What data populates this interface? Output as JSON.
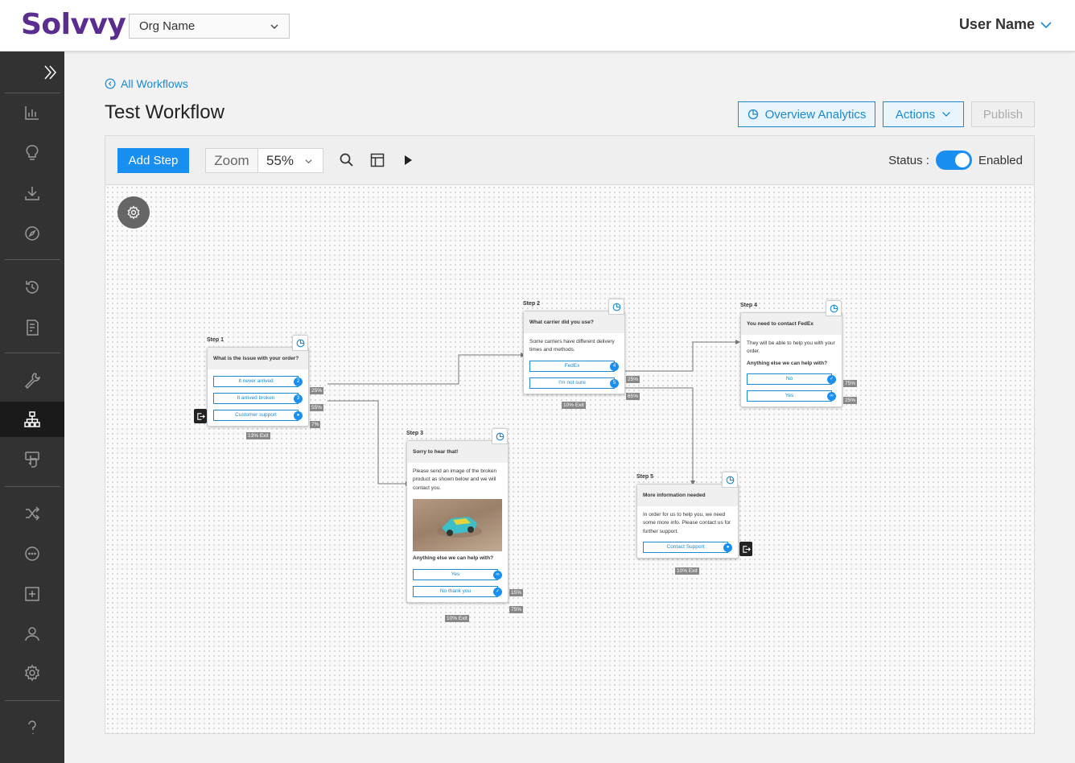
{
  "app": {
    "logo": "Solvvy",
    "org": "Org Name",
    "user": "User Name"
  },
  "sidebar": {
    "items": [
      {
        "name": "sidebar-expand",
        "icon": "double-chevron-right-icon"
      },
      {
        "name": "sidebar-item-analytics",
        "icon": "bar-chart-icon"
      },
      {
        "name": "sidebar-item-insights",
        "icon": "lightbulb-icon"
      },
      {
        "name": "sidebar-item-import",
        "icon": "download-icon"
      },
      {
        "name": "sidebar-item-explore",
        "icon": "compass-icon"
      },
      {
        "name": "sidebar-item-history",
        "icon": "history-icon"
      },
      {
        "name": "sidebar-item-reports",
        "icon": "report-icon"
      },
      {
        "name": "sidebar-item-tools",
        "icon": "wrench-icon"
      },
      {
        "name": "sidebar-item-workflows",
        "icon": "workflow-icon"
      },
      {
        "name": "sidebar-item-interactions",
        "icon": "touch-icon"
      },
      {
        "name": "sidebar-item-routing",
        "icon": "shuffle-icon"
      },
      {
        "name": "sidebar-item-chat",
        "icon": "chat-icon"
      },
      {
        "name": "sidebar-item-add",
        "icon": "plus-square-icon"
      },
      {
        "name": "sidebar-item-users",
        "icon": "users-icon"
      },
      {
        "name": "sidebar-item-settings",
        "icon": "gear-icon"
      },
      {
        "name": "sidebar-item-help",
        "icon": "help-icon"
      }
    ]
  },
  "page": {
    "back_label": "All Workflows",
    "title": "Test Workflow",
    "overview_label": "Overview Analytics",
    "actions_label": "Actions",
    "publish_label": "Publish"
  },
  "toolbar": {
    "add_step_label": "Add Step",
    "zoom_label": "Zoom",
    "zoom_value": "55%",
    "status_label": "Status :",
    "status_value": "Enabled",
    "enabled": true
  },
  "steps": [
    {
      "label": "Step 1",
      "title": "What is the issue with your order?",
      "body": "",
      "question": "",
      "options": [
        {
          "text": "It never arrived",
          "badge": "2",
          "pct": "25%"
        },
        {
          "text": "It arrived broken",
          "badge": "3",
          "pct": "55%"
        },
        {
          "text": "Customer support",
          "badge": "person-icon",
          "pct": "7%"
        }
      ],
      "exit": "13% Exit"
    },
    {
      "label": "Step 2",
      "title": "What carrier did you use?",
      "body": "Some carriers have different delivery times and methods.",
      "question": "",
      "options": [
        {
          "text": "FedEx",
          "badge": "4",
          "pct": "25%"
        },
        {
          "text": "I'm not sure",
          "badge": "5",
          "pct": "65%"
        }
      ],
      "exit": "10% Exit"
    },
    {
      "label": "Step 3",
      "title": "Sorry to hear that!",
      "body": "Please send an image of the broken product as shown below and we will contact you.",
      "question": "Anything else we can help with?",
      "options": [
        {
          "text": "Yes",
          "badge": "link-icon",
          "pct": "15%"
        },
        {
          "text": "No thank you",
          "badge": "check-icon",
          "pct": "75%"
        }
      ],
      "exit": "10% Exit"
    },
    {
      "label": "Step 4",
      "title": "You need to contact FedEx",
      "body": "They will be able to help you with your order.",
      "question": "Anything else we can help with?",
      "options": [
        {
          "text": "No",
          "badge": "check-icon",
          "pct": "75%"
        },
        {
          "text": "Yes",
          "badge": "link-icon",
          "pct": "25%"
        }
      ],
      "exit": ""
    },
    {
      "label": "Step 5",
      "title": "More information needed",
      "body": "In order for us to help you, we need some more info. Please contact us for further support.",
      "question": "",
      "options": [
        {
          "text": "Contact Support",
          "badge": "person-icon",
          "pct": ""
        }
      ],
      "exit": "10% Exit"
    }
  ],
  "colors": {
    "brand": "#5b2d8e",
    "accent": "#1a8ff2",
    "link": "#1a8ad1",
    "sidebar": "#323232"
  }
}
